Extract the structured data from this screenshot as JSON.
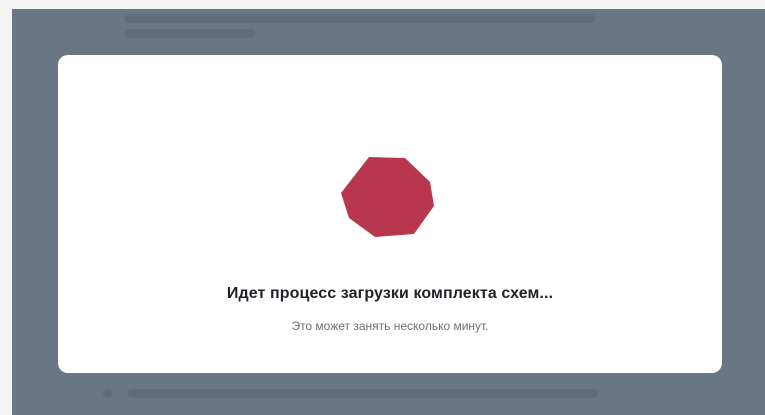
{
  "colors": {
    "overlay": "#697683",
    "modal_background": "#ffffff",
    "spinner": "#b9364f",
    "title_text": "#1f2328",
    "subtitle_text": "#6b6f75"
  },
  "loading_modal": {
    "spinner_icon": "loading-octagon",
    "title": "Идет процесс загрузки комплекта схем...",
    "subtitle": "Это может занять несколько минут."
  }
}
